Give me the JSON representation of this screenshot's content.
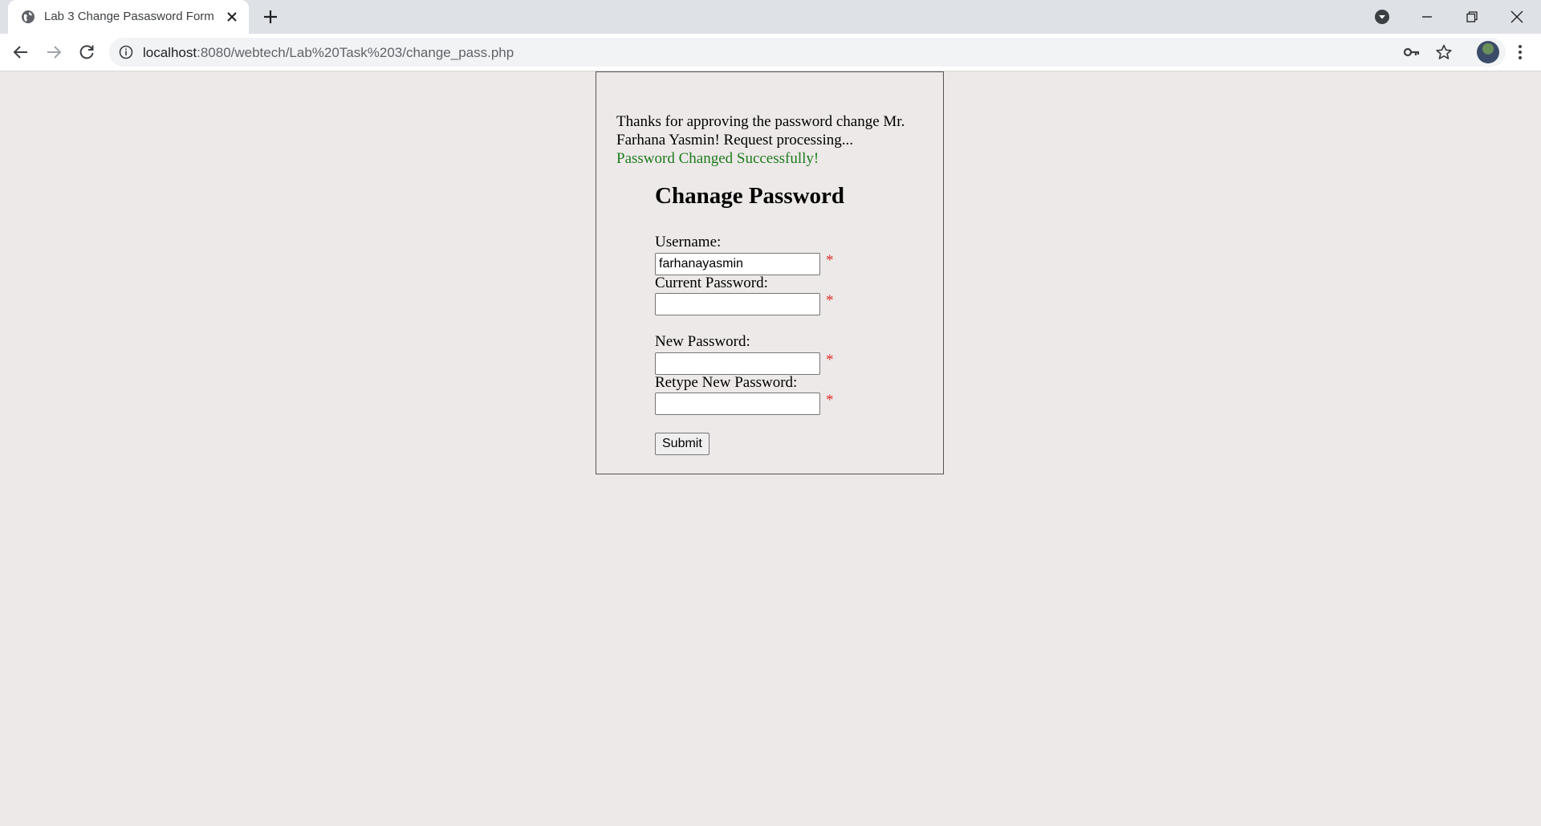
{
  "browser": {
    "tab_title": "Lab 3 Change Pasasword Form",
    "url_host": "localhost",
    "url_path": ":8080/webtech/Lab%20Task%203/change_pass.php"
  },
  "page": {
    "message": "Thanks for approving the password change Mr. Farhana Yasmin! Request processing...",
    "success": "Password Changed Successfully!",
    "form": {
      "title": "Chanage Password",
      "username_label": "Username:",
      "username_value": "farhanayasmin",
      "current_password_label": "Current Password:",
      "current_password_value": "",
      "new_password_label": "New Password:",
      "new_password_value": "",
      "retype_password_label": "Retype New Password:",
      "retype_password_value": "",
      "required_mark": "*",
      "submit_label": "Submit"
    }
  },
  "colors": {
    "success": "#1e7b1e",
    "required": "#e0322f",
    "page_background": "#ede9e8"
  }
}
